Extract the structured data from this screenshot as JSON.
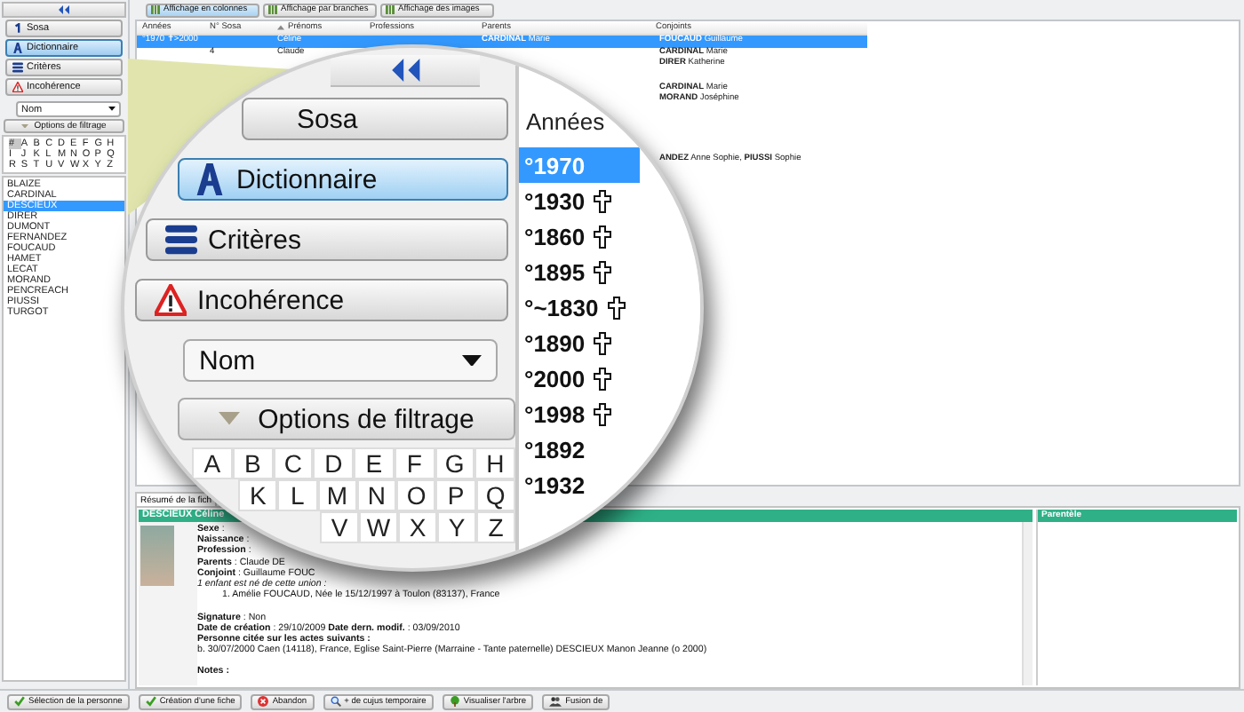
{
  "sidebar": {
    "nav": [
      {
        "label": "Sosa",
        "kind": "sosa",
        "selected": false
      },
      {
        "label": "Dictionnaire",
        "kind": "dictionary",
        "selected": true
      },
      {
        "label": "Critères",
        "kind": "criteria",
        "selected": false
      },
      {
        "label": "Incohérence",
        "kind": "warning",
        "selected": false
      }
    ],
    "sort_select": "Nom",
    "filter_options": "Options de filtrage",
    "alphabet": [
      [
        {
          "label": "#",
          "selected": true
        },
        {
          "label": "A",
          "selected": false
        },
        {
          "label": "B",
          "selected": false
        },
        {
          "label": "C",
          "selected": false
        },
        {
          "label": "D",
          "selected": false
        },
        {
          "label": "E",
          "selected": false
        },
        {
          "label": "F",
          "selected": false
        },
        {
          "label": "G",
          "selected": false
        },
        {
          "label": "H",
          "selected": false
        }
      ],
      [
        {
          "label": "I",
          "selected": false
        },
        {
          "label": "J",
          "selected": false
        },
        {
          "label": "K",
          "selected": false
        },
        {
          "label": "L",
          "selected": false
        },
        {
          "label": "M",
          "selected": false
        },
        {
          "label": "N",
          "selected": false
        },
        {
          "label": "O",
          "selected": false
        },
        {
          "label": "P",
          "selected": false
        },
        {
          "label": "Q",
          "selected": false
        }
      ],
      [
        {
          "label": "R",
          "selected": false
        },
        {
          "label": "S",
          "selected": false
        },
        {
          "label": "T",
          "selected": false
        },
        {
          "label": "U",
          "selected": false
        },
        {
          "label": "V",
          "selected": false
        },
        {
          "label": "W",
          "selected": false
        },
        {
          "label": "X",
          "selected": false
        },
        {
          "label": "Y",
          "selected": false
        },
        {
          "label": "Z",
          "selected": false
        }
      ]
    ],
    "names": [
      {
        "label": "BLAIZE",
        "selected": false
      },
      {
        "label": "CARDINAL",
        "selected": false
      },
      {
        "label": "DESCIEUX",
        "selected": true
      },
      {
        "label": "DIRER",
        "selected": false
      },
      {
        "label": "DUMONT",
        "selected": false
      },
      {
        "label": "FERNANDEZ",
        "selected": false
      },
      {
        "label": "FOUCAUD",
        "selected": false
      },
      {
        "label": "HAMET",
        "selected": false
      },
      {
        "label": "LECAT",
        "selected": false
      },
      {
        "label": "MORAND",
        "selected": false
      },
      {
        "label": "PENCREACH",
        "selected": false
      },
      {
        "label": "PIUSSI",
        "selected": false
      },
      {
        "label": "TURGOT",
        "selected": false
      }
    ]
  },
  "toolbar": [
    {
      "label": "Affichage en colonnes",
      "selected": true
    },
    {
      "label": "Affichage par branches",
      "selected": false
    },
    {
      "label": "Affichage des images",
      "selected": false
    }
  ],
  "table": {
    "columns": [
      {
        "label": "Années",
        "sorted": false
      },
      {
        "label": "N° Sosa",
        "sorted": false
      },
      {
        "label": "Prénoms",
        "sorted": true
      },
      {
        "label": "Professions",
        "sorted": false
      },
      {
        "label": "Parents",
        "sorted": false
      },
      {
        "label": "Conjoints",
        "sorted": false
      }
    ],
    "rows": [
      {
        "years": "°1970 ✝>2000",
        "given_names": "Céline",
        "parents": "**CARDINAL** Marie",
        "spouses": "**FOUCAUD** Guillaume",
        "selected": true
      },
      {
        "sosa": "4",
        "given_names": "Claude",
        "spouses": "**CARDINAL** Marie",
        "selected": false
      },
      {
        "spouses": "**DIRER** Katherine",
        "selected": false
      },
      {
        "selected": false
      },
      {
        "spouses": "**CARDINAL** Marie",
        "selected": false
      },
      {
        "spouses": "**MORAND** Joséphine",
        "selected": false
      },
      {
        "selected": false
      },
      {
        "selected": false
      },
      {
        "selected": false
      },
      {
        "selected": false
      },
      {
        "spouses": "**ANDEZ** Anne Sophie, **PIUSSI** Sophie",
        "selected": false
      }
    ]
  },
  "magnifier": {
    "nav": [
      {
        "label": "Sosa",
        "selected": false
      },
      {
        "label": "Dictionnaire",
        "kind": "dictionary",
        "selected": true
      },
      {
        "label": "Critères",
        "kind": "criteria",
        "selected": false
      },
      {
        "label": "Incohérence",
        "kind": "warning",
        "selected": false
      }
    ],
    "sort_select": "Nom",
    "filter_options": "Options de filtrage",
    "alphabet": [
      [
        "A",
        "B",
        "C",
        "D",
        "E",
        "F",
        "G",
        "H"
      ],
      [
        "K",
        "L",
        "M",
        "N",
        "O",
        "P",
        "Q"
      ],
      [
        "V",
        "W",
        "X",
        "Y",
        "Z"
      ]
    ],
    "years_header": "Années",
    "years": [
      {
        "label": "°1970",
        "selected": true,
        "deceased": false
      },
      {
        "label": "°1930",
        "selected": false,
        "deceased": true
      },
      {
        "label": "°1860",
        "selected": false,
        "deceased": true
      },
      {
        "label": "°1895",
        "selected": false,
        "deceased": true
      },
      {
        "label": "°~1830",
        "selected": false,
        "deceased": true
      },
      {
        "label": "°1890",
        "selected": false,
        "deceased": true
      },
      {
        "label": "°2000",
        "selected": false,
        "deceased": true
      },
      {
        "label": "°1998",
        "selected": false,
        "deceased": true
      },
      {
        "label": "°1892",
        "selected": false,
        "deceased": false
      },
      {
        "label": "°1932",
        "selected": false,
        "deceased": false
      }
    ]
  },
  "details": {
    "tab": "Résumé de la fich",
    "name": "DESCIEUX Céline",
    "lines": [
      {
        "kind": "field",
        "text": "**Sexe** :"
      },
      {
        "kind": "field",
        "text": "**Naissance** :"
      },
      {
        "kind": "field",
        "text": "**Profession** :"
      },
      {
        "kind": "field",
        "text": "**Parents** : Claude DE"
      },
      {
        "kind": "field",
        "text": "**Conjoint** : Guillaume FOUC"
      },
      {
        "kind": "italic",
        "text": "1 enfant est né de cette union :"
      },
      {
        "kind": "indent",
        "text": "1. Amélie FOUCAUD, Née le 15/12/1997 à Toulon (83137), France"
      },
      {
        "kind": "gap"
      },
      {
        "kind": "field",
        "text": "**Signature** : Non"
      },
      {
        "kind": "field",
        "text": "**Date de création** : 29/10/2009 **Date dern. modif.** : 03/09/2010"
      },
      {
        "kind": "heading",
        "text": "Personne citée sur les actes suivants :"
      },
      {
        "kind": "field",
        "text": "b. 30/07/2000 Caen (14118), France, Eglise Saint-Pierre  (Marraine - Tante paternelle) DESCIEUX Manon Jeanne (o 2000)"
      },
      {
        "kind": "gap"
      },
      {
        "kind": "heading",
        "text": "Notes :"
      }
    ],
    "related_header": "Parentèle"
  },
  "actions": [
    {
      "label": "Sélection de la personne",
      "kind": "check"
    },
    {
      "label": "Création d'une fiche",
      "kind": "check"
    },
    {
      "label": "Abandon",
      "kind": "cancel"
    },
    {
      "label": "+ de cujus temporaire",
      "kind": "search"
    },
    {
      "label": "Visualiser l'arbre",
      "kind": "tree"
    },
    {
      "label": "Fusion de",
      "kind": "people"
    }
  ]
}
